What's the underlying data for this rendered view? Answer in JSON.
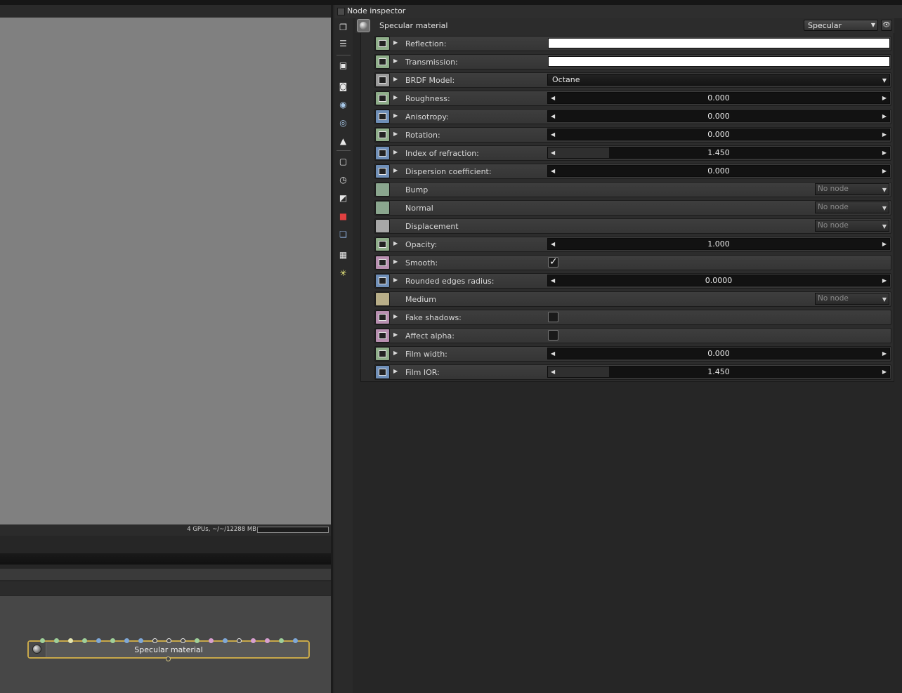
{
  "status": {
    "gpu_text": "4 GPUs, ~/~/12288 MB"
  },
  "graph": {
    "node_label": "Specular material"
  },
  "inspector": {
    "title": "Node inspector",
    "material_name": "Specular material",
    "material_type": "Specular"
  },
  "params": [
    {
      "label": "Reflection:",
      "kind": "color",
      "pin_color": "#8fae8a",
      "value": "#ffffff"
    },
    {
      "label": "Transmission:",
      "kind": "color",
      "pin_color": "#8fae8a",
      "value": "#ffffff"
    },
    {
      "label": "BRDF Model:",
      "kind": "enum",
      "pin_color": "#9a9a9a",
      "value": "Octane"
    },
    {
      "label": "Roughness:",
      "kind": "float",
      "pin_color": "#8fae8a",
      "value": "0.000",
      "fraction": 0.0
    },
    {
      "label": "Anisotropy:",
      "kind": "float",
      "pin_color": "#6f8fb8",
      "value": "0.000",
      "fraction": 0.0
    },
    {
      "label": "Rotation:",
      "kind": "float",
      "pin_color": "#8fae8a",
      "value": "0.000",
      "fraction": 0.0
    },
    {
      "label": "Index of refraction:",
      "kind": "float",
      "pin_color": "#6f8fb8",
      "value": "1.450",
      "fraction": 0.18
    },
    {
      "label": "Dispersion coefficient:",
      "kind": "float",
      "pin_color": "#6f8fb8",
      "value": "0.000",
      "fraction": 0.0
    },
    {
      "label": "Bump",
      "kind": "node",
      "pin_color": "#8aa68e",
      "value": "No node"
    },
    {
      "label": "Normal",
      "kind": "node",
      "pin_color": "#8aa68e",
      "value": "No node"
    },
    {
      "label": "Displacement",
      "kind": "node",
      "pin_color": "#a8a8a8",
      "value": "No node"
    },
    {
      "label": "Opacity:",
      "kind": "float",
      "pin_color": "#8fae8a",
      "value": "1.000",
      "fraction": 0.0
    },
    {
      "label": "Smooth:",
      "kind": "bool",
      "pin_color": "#b88fb0",
      "value": true
    },
    {
      "label": "Rounded edges radius:",
      "kind": "float",
      "pin_color": "#6f8fb8",
      "value": "0.0000",
      "fraction": 0.0
    },
    {
      "label": "Medium",
      "kind": "node",
      "pin_color": "#b8ae88",
      "value": "No node"
    },
    {
      "label": "Fake shadows:",
      "kind": "bool",
      "pin_color": "#b88fb0",
      "value": false
    },
    {
      "label": "Affect alpha:",
      "kind": "bool",
      "pin_color": "#b88fb0",
      "value": false
    },
    {
      "label": "Film width:",
      "kind": "float",
      "pin_color": "#8fae8a",
      "value": "0.000",
      "fraction": 0.0
    },
    {
      "label": "Film IOR:",
      "kind": "float",
      "pin_color": "#6f8fb8",
      "value": "1.450",
      "fraction": 0.18
    }
  ],
  "toolbar_icons": [
    "stacked-windows-icon",
    "list-lines-icon",
    "image-icon",
    "camera-icon",
    "database-icon",
    "refresh-disk-icon",
    "shapes-icon",
    "frame-icon",
    "clock-icon",
    "chart-icon",
    "red-cube-icon",
    "blue-cubes-icon",
    "picture-frame-icon",
    "sun-icon"
  ],
  "graph_pin_colors": [
    "#9fd09a",
    "#9fd09a",
    "#e6e6b0",
    "#9fd09a",
    "#7fa8d8",
    "#9fd09a",
    "#7fa8d8",
    "#7fa8d8",
    "hollow",
    "hollow",
    "hollow",
    "#9fd09a",
    "#d8a0d0",
    "#7fa8d8",
    "hollow",
    "#d8a0d0",
    "#d8a0d0",
    "#9fd09a",
    "#7fa8d8"
  ]
}
